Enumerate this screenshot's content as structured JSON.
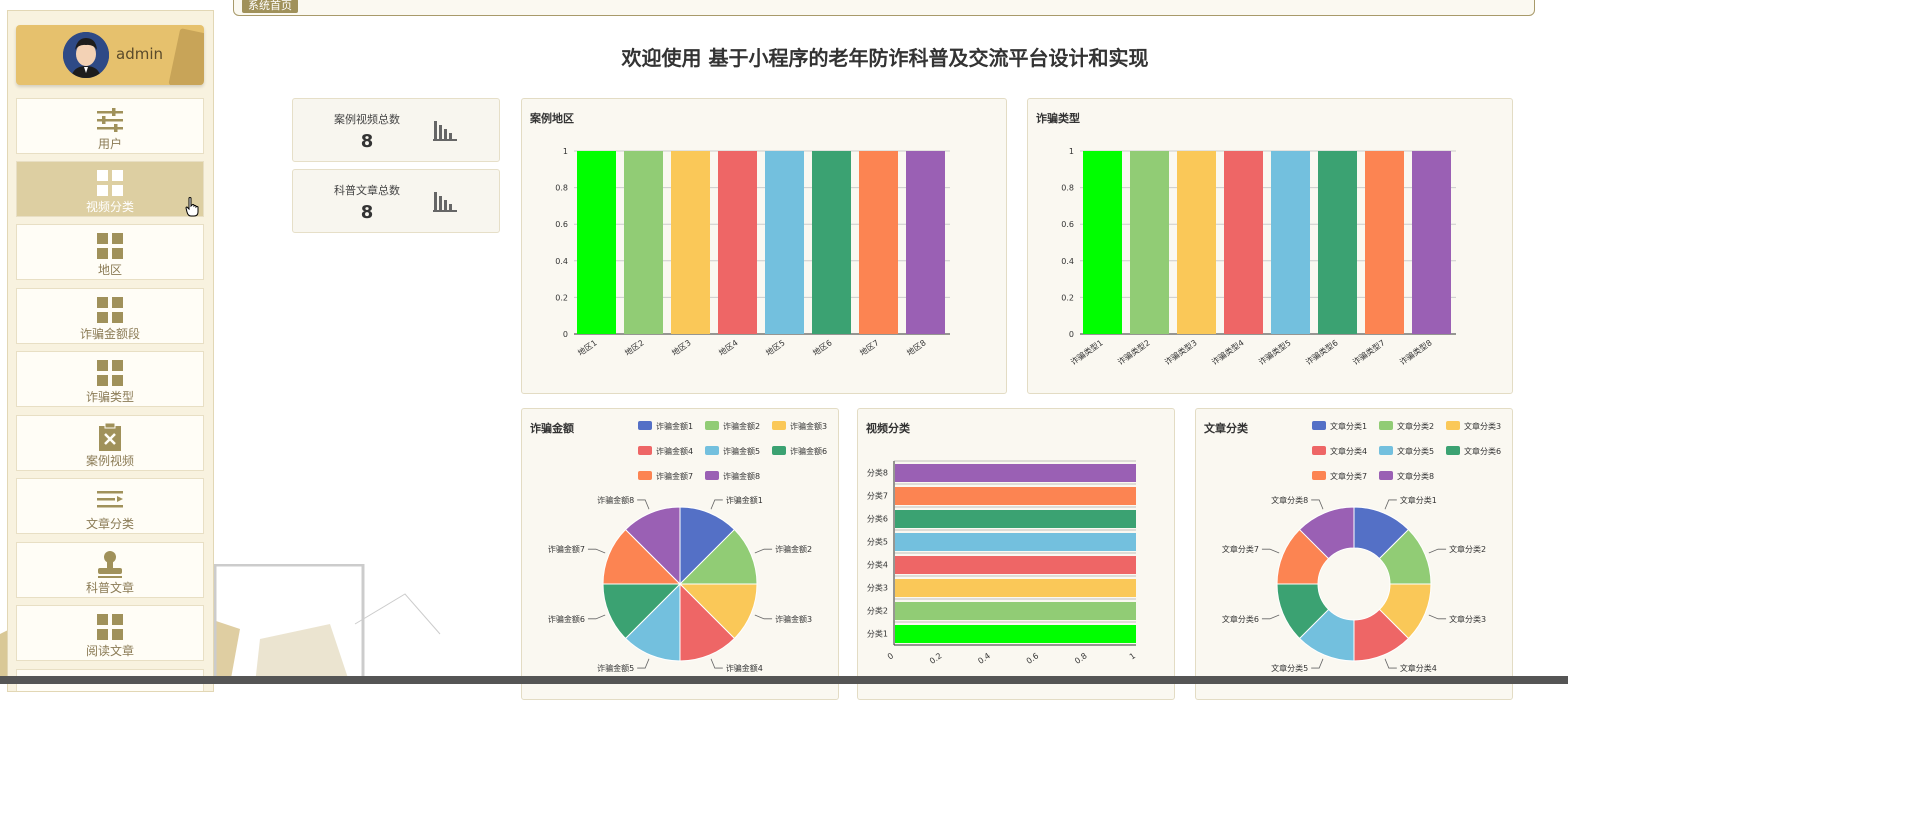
{
  "breadcrumb": {
    "label": "系统首页"
  },
  "user": {
    "name": "admin"
  },
  "sidebar": {
    "items": [
      {
        "label": "用户",
        "icon": "sliders-icon",
        "active": false
      },
      {
        "label": "视频分类",
        "icon": "grid-icon",
        "active": true
      },
      {
        "label": "地区",
        "icon": "grid-icon",
        "active": false
      },
      {
        "label": "诈骗金额段",
        "icon": "grid-icon",
        "active": false
      },
      {
        "label": "诈骗类型",
        "icon": "grid-icon",
        "active": false
      },
      {
        "label": "案例视频",
        "icon": "clipboard-x-icon",
        "active": false
      },
      {
        "label": "文章分类",
        "icon": "list-icon",
        "active": false
      },
      {
        "label": "科普文章",
        "icon": "stamp-icon",
        "active": false
      },
      {
        "label": "阅读文章",
        "icon": "grid-icon",
        "active": false
      }
    ]
  },
  "page": {
    "title": "欢迎使用 基于小程序的老年防诈科普及交流平台设计和实现"
  },
  "stats": [
    {
      "label": "案例视频总数",
      "value": "8"
    },
    {
      "label": "科普文章总数",
      "value": "8"
    }
  ],
  "colors": {
    "accent": "#e6c16d",
    "series": [
      "#00ff00",
      "#91cc75",
      "#fac858",
      "#ee6666",
      "#73c0de",
      "#3ba272",
      "#fc8452",
      "#9a60b4"
    ],
    "pie": [
      "#5470c6",
      "#91cc75",
      "#fac858",
      "#ee6666",
      "#73c0de",
      "#3ba272",
      "#fc8452",
      "#9a60b4"
    ]
  },
  "chart_data": [
    {
      "type": "bar",
      "title": "案例地区",
      "categories": [
        "地区1",
        "地区2",
        "地区3",
        "地区4",
        "地区5",
        "地区6",
        "地区7",
        "地区8"
      ],
      "values": [
        1,
        1,
        1,
        1,
        1,
        1,
        1,
        1
      ],
      "yticks": [
        "0",
        "0.2",
        "0.4",
        "0.6",
        "0.8",
        "1"
      ],
      "ylim": [
        0,
        1
      ]
    },
    {
      "type": "bar",
      "title": "诈骗类型",
      "categories": [
        "诈骗类型1",
        "诈骗类型2",
        "诈骗类型3",
        "诈骗类型4",
        "诈骗类型5",
        "诈骗类型6",
        "诈骗类型7",
        "诈骗类型8"
      ],
      "values": [
        1,
        1,
        1,
        1,
        1,
        1,
        1,
        1
      ],
      "yticks": [
        "0",
        "0.2",
        "0.4",
        "0.6",
        "0.8",
        "1"
      ],
      "ylim": [
        0,
        1
      ]
    },
    {
      "type": "pie",
      "title": "诈骗金额",
      "categories": [
        "诈骗金额1",
        "诈骗金额2",
        "诈骗金额3",
        "诈骗金额4",
        "诈骗金额5",
        "诈骗金额6",
        "诈骗金额7",
        "诈骗金额8"
      ],
      "values": [
        1,
        1,
        1,
        1,
        1,
        1,
        1,
        1
      ],
      "legend": "top-right"
    },
    {
      "type": "bar",
      "orientation": "horizontal",
      "title": "视频分类",
      "categories": [
        "分类1",
        "分类2",
        "分类3",
        "分类4",
        "分类5",
        "分类6",
        "分类7",
        "分类8"
      ],
      "values": [
        1,
        1,
        1,
        1,
        1,
        1,
        1,
        1
      ],
      "xticks": [
        "0",
        "0.2",
        "0.4",
        "0.6",
        "0.8",
        "1"
      ],
      "xlim": [
        0,
        1
      ]
    },
    {
      "type": "pie",
      "subtype": "donut",
      "title": "文章分类",
      "categories": [
        "文章分类1",
        "文章分类2",
        "文章分类3",
        "文章分类4",
        "文章分类5",
        "文章分类6",
        "文章分类7",
        "文章分类8"
      ],
      "values": [
        1,
        1,
        1,
        1,
        1,
        1,
        1,
        1
      ],
      "legend": "top-right"
    }
  ]
}
